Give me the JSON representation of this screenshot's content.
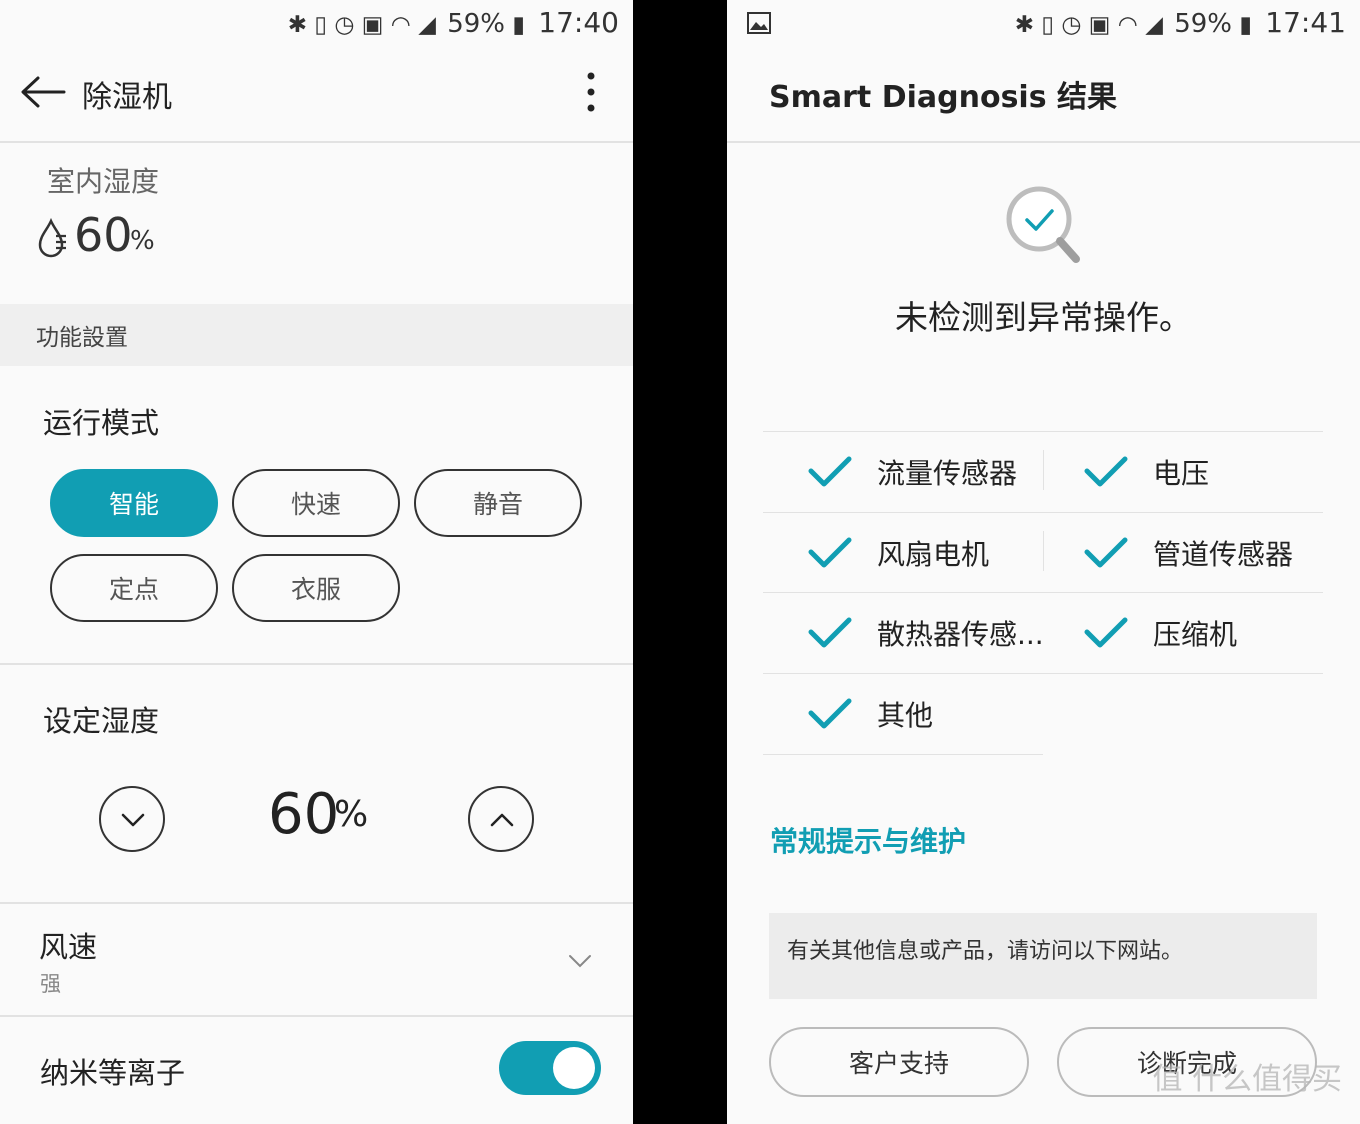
{
  "left": {
    "status": {
      "battery_pct": "59%",
      "time": "17:40"
    },
    "appbar": {
      "title": "除湿机"
    },
    "indoor": {
      "label": "室内湿度",
      "value": "60",
      "unit": "%"
    },
    "section_title": "功能設置",
    "mode": {
      "heading": "运行模式",
      "options": [
        "智能",
        "快速",
        "静音",
        "定点",
        "衣服"
      ],
      "selected": "智能"
    },
    "set_humidity": {
      "heading": "设定湿度",
      "value": "60",
      "unit": "%"
    },
    "fan": {
      "label": "风速",
      "value": "强"
    },
    "ion": {
      "label": "纳米等离子",
      "on": true
    }
  },
  "right": {
    "status": {
      "battery_pct": "59%",
      "time": "17:41"
    },
    "appbar": {
      "title": "Smart Diagnosis 结果"
    },
    "result_message": "未检测到异常操作。",
    "checks": [
      "流量传感器",
      "电压",
      "风扇电机",
      "管道传感器",
      "散热器传感...",
      "压缩机",
      "其他"
    ],
    "tips_heading": "常规提示与维护",
    "info_text": "有关其他信息或产品，请访问以下网站。",
    "buttons": {
      "support": "客户支持",
      "done": "诊断完成"
    },
    "watermark": "值 什么值得买"
  },
  "colors": {
    "accent": "#119eb3",
    "band": "#efefef",
    "divider": "#e2e2e2"
  }
}
